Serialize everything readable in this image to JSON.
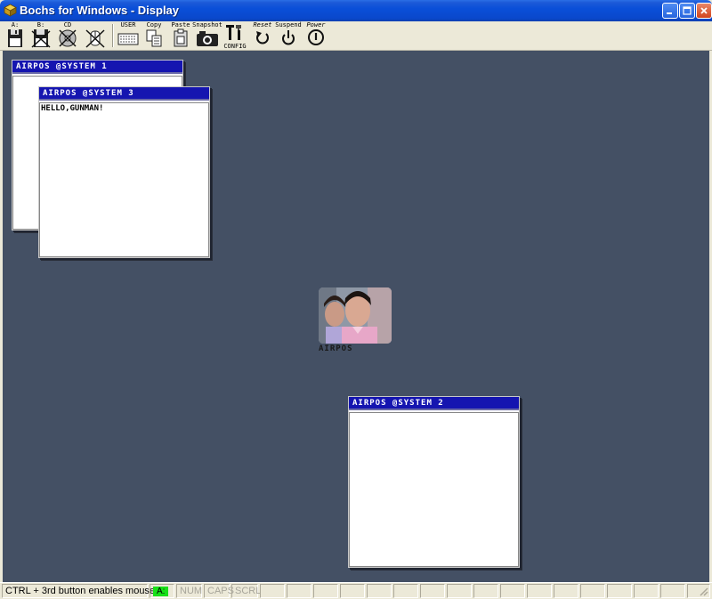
{
  "window": {
    "title": "Bochs for Windows - Display",
    "icon": "bochs-app-icon"
  },
  "toolbar": {
    "items": [
      {
        "label": "A:",
        "icon": "floppy-a-icon"
      },
      {
        "label": "B:",
        "icon": "floppy-b-icon"
      },
      {
        "label": "CD",
        "icon": "cdrom-icon"
      },
      {
        "label": "",
        "icon": "mouse-disabled-icon"
      },
      {
        "label": "USER",
        "icon": "keyboard-icon"
      },
      {
        "label": "Copy",
        "icon": "copy-icon"
      },
      {
        "label": "Paste",
        "icon": "paste-icon"
      },
      {
        "label": "Snapshot",
        "icon": "camera-icon"
      },
      {
        "label": "CONFIG",
        "icon": "config-icon"
      },
      {
        "label": "Reset",
        "icon": "reset-icon"
      },
      {
        "label": "Suspend",
        "icon": "suspend-icon"
      },
      {
        "label": "Power",
        "icon": "power-icon"
      }
    ]
  },
  "desktop": {
    "background": "#445064",
    "windows": [
      {
        "title": "AIRPOS @SYSTEM 1",
        "content": ""
      },
      {
        "title": "AIRPOS @SYSTEM 3",
        "content": "HELLO,GUNMAN!"
      },
      {
        "title": "AIRPOS @SYSTEM 2",
        "content": ""
      }
    ],
    "icon": {
      "label": "AIRPOS",
      "image": "photo-of-two-people"
    }
  },
  "statusbar": {
    "message": "CTRL + 3rd button enables mouse",
    "drive": "A:",
    "drive_color": "#18e018",
    "num": "NUM",
    "caps": "CAPS",
    "scrl": "SCRL"
  }
}
